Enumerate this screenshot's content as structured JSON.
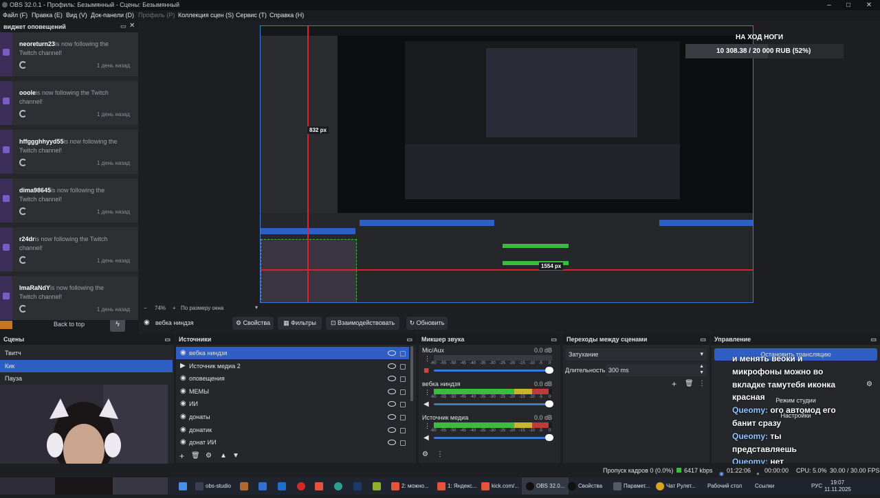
{
  "window": {
    "title": "OBS 32.0.1 - Профиль: Безымянный - Сцены: Безымянный",
    "controls": [
      "–",
      "□",
      "✕"
    ]
  },
  "menu": {
    "items": [
      "Файл (F)",
      "Правка (E)",
      "Вид (V)",
      "Док-панели (D)",
      "Профиль (P)",
      "Коллекция сцен (S)",
      "Сервис (T)",
      "Справка (H)"
    ]
  },
  "alerts": {
    "title": "виджет оповещений",
    "items": [
      {
        "user": "neoreturn23",
        "text": "is now following the Twitch channel!",
        "time": "1 день назад"
      },
      {
        "user": "ooole",
        "text": "is now following the Twitch channel!",
        "time": "1 день назад"
      },
      {
        "user": "hffggghhyyd55",
        "text": "is now following the Twitch channel!",
        "time": "1 день назад"
      },
      {
        "user": "dima98645",
        "text": "is now following the Twitch channel!",
        "time": "1 день назад"
      },
      {
        "user": "r24dr",
        "text": "is now following the Twitch channel!",
        "time": "1 день назад"
      },
      {
        "user": "lmaRaNdY",
        "text": "is now following the Twitch channel!",
        "time": "1 день назад"
      }
    ],
    "back_to_top": "Back to top"
  },
  "preview": {
    "donation_title": "НА ХОД НОГИ",
    "donation_progress": "10 308.38 / 20 000 RUB (52%)",
    "donation_fraction": 0.52,
    "measure_1": "832 px",
    "measure_2": "1554 px",
    "zoom": "74%",
    "zoom_mode": "По размеру окна"
  },
  "source_bar": {
    "selected_source": "вебка ниндзя",
    "properties": "Свойства",
    "filters": "Фильтры",
    "interact": "Взаимодействовать",
    "refresh": "Обновить"
  },
  "scenes": {
    "title": "Сцены",
    "items": [
      "Твитч",
      "Кик",
      "Пауза"
    ],
    "selected": 1
  },
  "sources": {
    "title": "Источники",
    "items": [
      "вебка ниндзя",
      "Источник медиа 2",
      "оповещения",
      "МЕМЫ",
      "ИИ",
      "донаты",
      "донатик",
      "донат ИИ"
    ],
    "selected": 0
  },
  "mixer": {
    "title": "Микшер звука",
    "scale": [
      "-60",
      "-55",
      "-50",
      "-45",
      "-40",
      "-35",
      "-30",
      "-25",
      "-20",
      "-15",
      "-10",
      "-5",
      "0"
    ],
    "channels": [
      {
        "name": "Mic/Aux",
        "db": "0.0 dB",
        "level": 0.0,
        "muted": true
      },
      {
        "name": "вебка ниндзя",
        "db": "0.0 dB",
        "level": 0.97,
        "muted": false
      },
      {
        "name": "Источник медиа",
        "db": "0.0 dB",
        "level": 0.97,
        "muted": false
      }
    ]
  },
  "transitions": {
    "title": "Переходы между сценами",
    "selected": "Затухание",
    "duration_label": "Длительность",
    "duration_value": "300 ms"
  },
  "controls": {
    "title": "Управление",
    "stop_stream": "Остановить трансляцию",
    "studio_mode": "Режим студии",
    "settings": "Настройки"
  },
  "chat": {
    "lines": [
      {
        "text": "и менять веоки и",
        "blue": false
      },
      {
        "text": "микрофоны можно во",
        "blue": false
      },
      {
        "text": "вкладке тамутебя иконка",
        "blue": false
      },
      {
        "text": "красная",
        "blue": false
      },
      {
        "user": "Queomy:",
        "text": " ого автомод его",
        "blue": true
      },
      {
        "text": "банит сразу",
        "blue": false
      },
      {
        "user": "Queomy:",
        "text": " ты",
        "blue": true
      },
      {
        "text": "представляешь",
        "blue": false
      },
      {
        "user": "Queomy:",
        "text": " нет",
        "blue": true
      }
    ]
  },
  "status": {
    "dropped_frames": "Пропуск кадров 0 (0.0%)",
    "bitrate": "6417 kbps",
    "stream_time": "01:22:06",
    "rec_time": "00:00:00",
    "cpu": "CPU: 5.0%",
    "fps": "30.00 / 30.00 FPS"
  },
  "taskbar": {
    "items": [
      "obs-studio",
      "2: можно...",
      "1: Яндекс...",
      "kick.com/...",
      "OBS 32.0...",
      "Свойства",
      "Парамет...",
      "Чат Рулет...",
      "Рабочий стол",
      "Ссылки"
    ],
    "lang": "РУС",
    "time": "19:07",
    "date": "11.11.2025"
  },
  "colors": {
    "accent": "#2f5fc4",
    "twitch": "#7a5cc7",
    "meter_green": "#3dbb3d",
    "meter_yellow": "#c9b52b",
    "meter_red": "#c23b3b",
    "selection_red": "#e0202a"
  }
}
